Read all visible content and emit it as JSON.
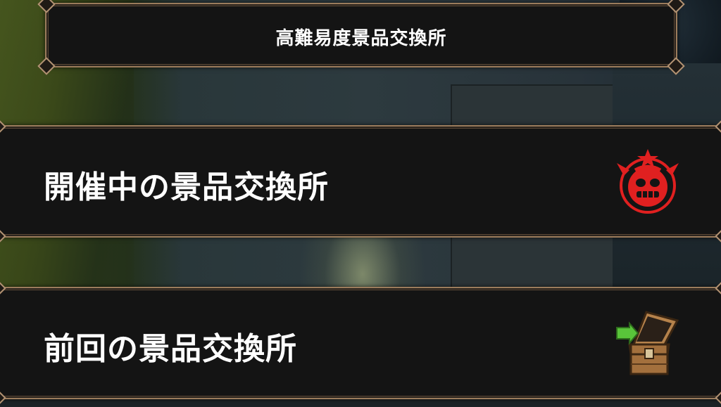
{
  "header": {
    "title": "高難易度景品交換所"
  },
  "menu": {
    "items": [
      {
        "label": "開催中の景品交換所",
        "icon": "red-demon-emblem-icon"
      },
      {
        "label": "前回の景品交換所",
        "icon": "treasure-chest-icon"
      }
    ]
  },
  "colors": {
    "panel": "#141414",
    "border": "#9b7c5c",
    "emblem_red": "#e02020",
    "text": "#ffffff"
  }
}
